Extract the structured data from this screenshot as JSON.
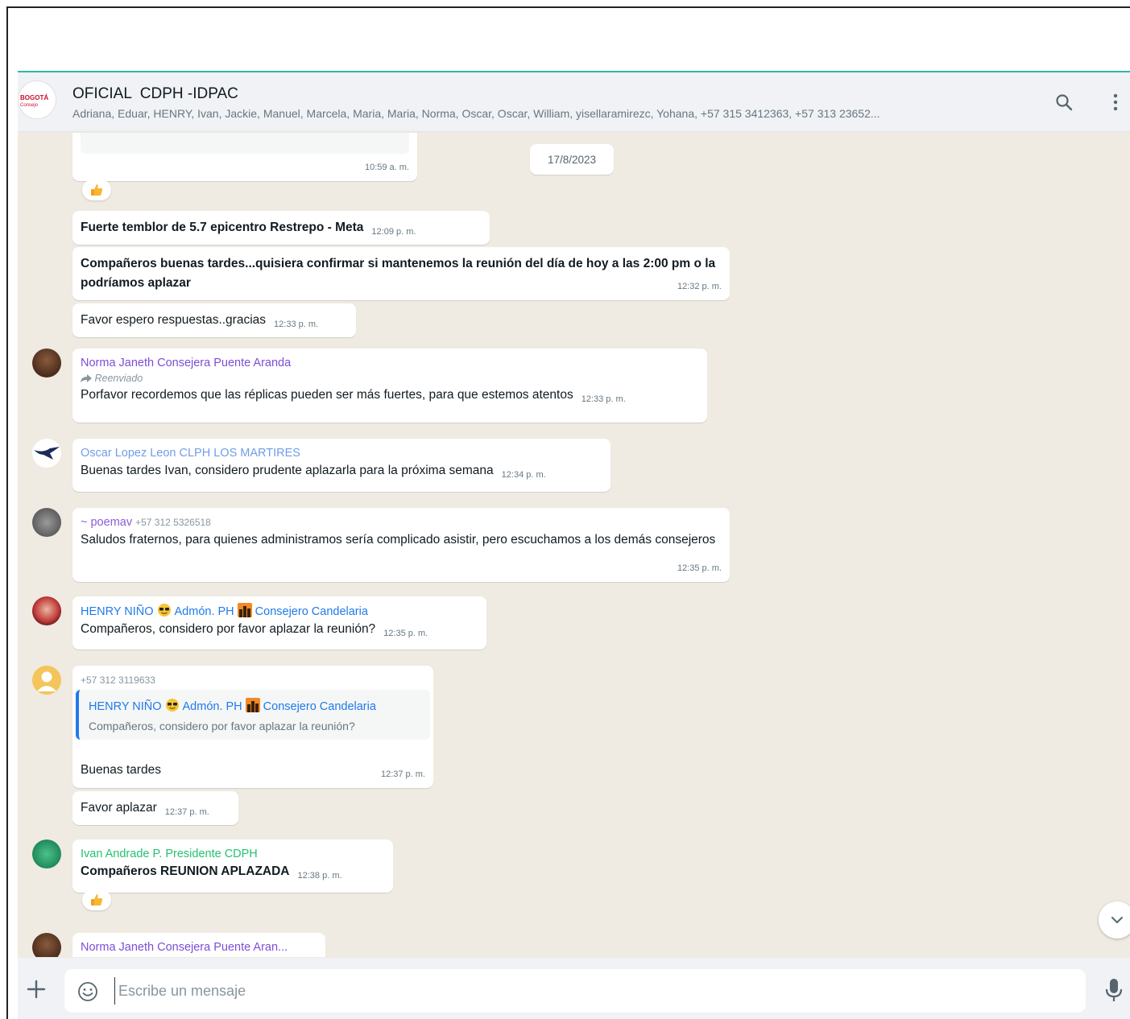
{
  "header": {
    "title": "OFICIAL  CDPH -IDPAC",
    "members": "Adriana, Eduar, HENRY, Ivan, Jackie, Manuel, Marcela, Maria, Maria, Norma, Oscar, Oscar, William, yisellaramirezc, Yohana, +57 315 3412363, +57 313 23652...",
    "avatar_line1": "BOGOTÁ",
    "avatar_line2": "Consejo"
  },
  "date_chip": "17/8/2023",
  "top_bubble_time": "10:59 a. m.",
  "messages": [
    {
      "text": "Fuerte temblor de 5.7 epicentro Restrepo - Meta",
      "time": "12:09 p. m."
    },
    {
      "text": "Compañeros buenas tardes...quisiera confirmar si mantenemos la reunión del día de hoy a las 2:00 pm o la podríamos aplazar",
      "time": "12:32 p. m."
    },
    {
      "text": "Favor espero respuestas..gracias",
      "time": "12:33 p. m."
    },
    {
      "sender": "Norma Janeth Consejera Puente Aranda",
      "forwarded": "Reenviado",
      "text": "Porfavor recordemos que las réplicas pueden ser más fuertes, para que estemos atentos",
      "time": "12:33 p. m."
    },
    {
      "sender": "Oscar Lopez Leon CLPH LOS MARTIRES",
      "text": "Buenas tardes Ivan, considero prudente aplazarla para la próxima semana",
      "time": "12:34 p. m."
    },
    {
      "sender": "~ poemav",
      "phone": "+57 312 5326518",
      "text": "Saludos fraternos, para quienes administramos sería complicado asistir, pero escuchamos a los demás consejeros",
      "time": "12:35 p. m."
    },
    {
      "sender_a": "HENRY NIÑO",
      "sender_b": "Admón. PH",
      "sender_c": "Consejero Candelaria",
      "text": "Compañeros, considero por favor aplazar la reunión?",
      "time": "12:35 p. m."
    },
    {
      "phone": "+57 312 3119633",
      "quote_a": "HENRY NIÑO",
      "quote_b": "Admón. PH",
      "quote_c": "Consejero Candelaria",
      "quote_text": "Compañeros, considero por favor aplazar la reunión?",
      "text": "Buenas tardes",
      "time": "12:37 p. m."
    },
    {
      "text": "Favor aplazar",
      "time": "12:37 p. m."
    },
    {
      "sender": "Ivan Andrade P. Presidente CDPH",
      "text": "Compañeros REUNION APLAZADA",
      "time": "12:38 p. m."
    },
    {
      "sender": "Norma Janeth Consejera Puente Aran..."
    }
  ],
  "composer": {
    "placeholder": "Escribe un mensaje"
  },
  "icons": {
    "search": "search-icon",
    "menu": "kebab-menu-icon",
    "emoji": "emoji-icon",
    "attach": "plus-icon",
    "mic": "mic-icon",
    "scroll": "chevron-down-icon"
  },
  "colors": {
    "accent": "#2fb8a5",
    "chat_bg": "#efeae2",
    "sender_norma": "#7c4dd6",
    "sender_oscar": "#6f9de8",
    "sender_poemav": "#8a5cd6",
    "sender_henry": "#1f7aec",
    "sender_ivan": "#25c16f"
  }
}
